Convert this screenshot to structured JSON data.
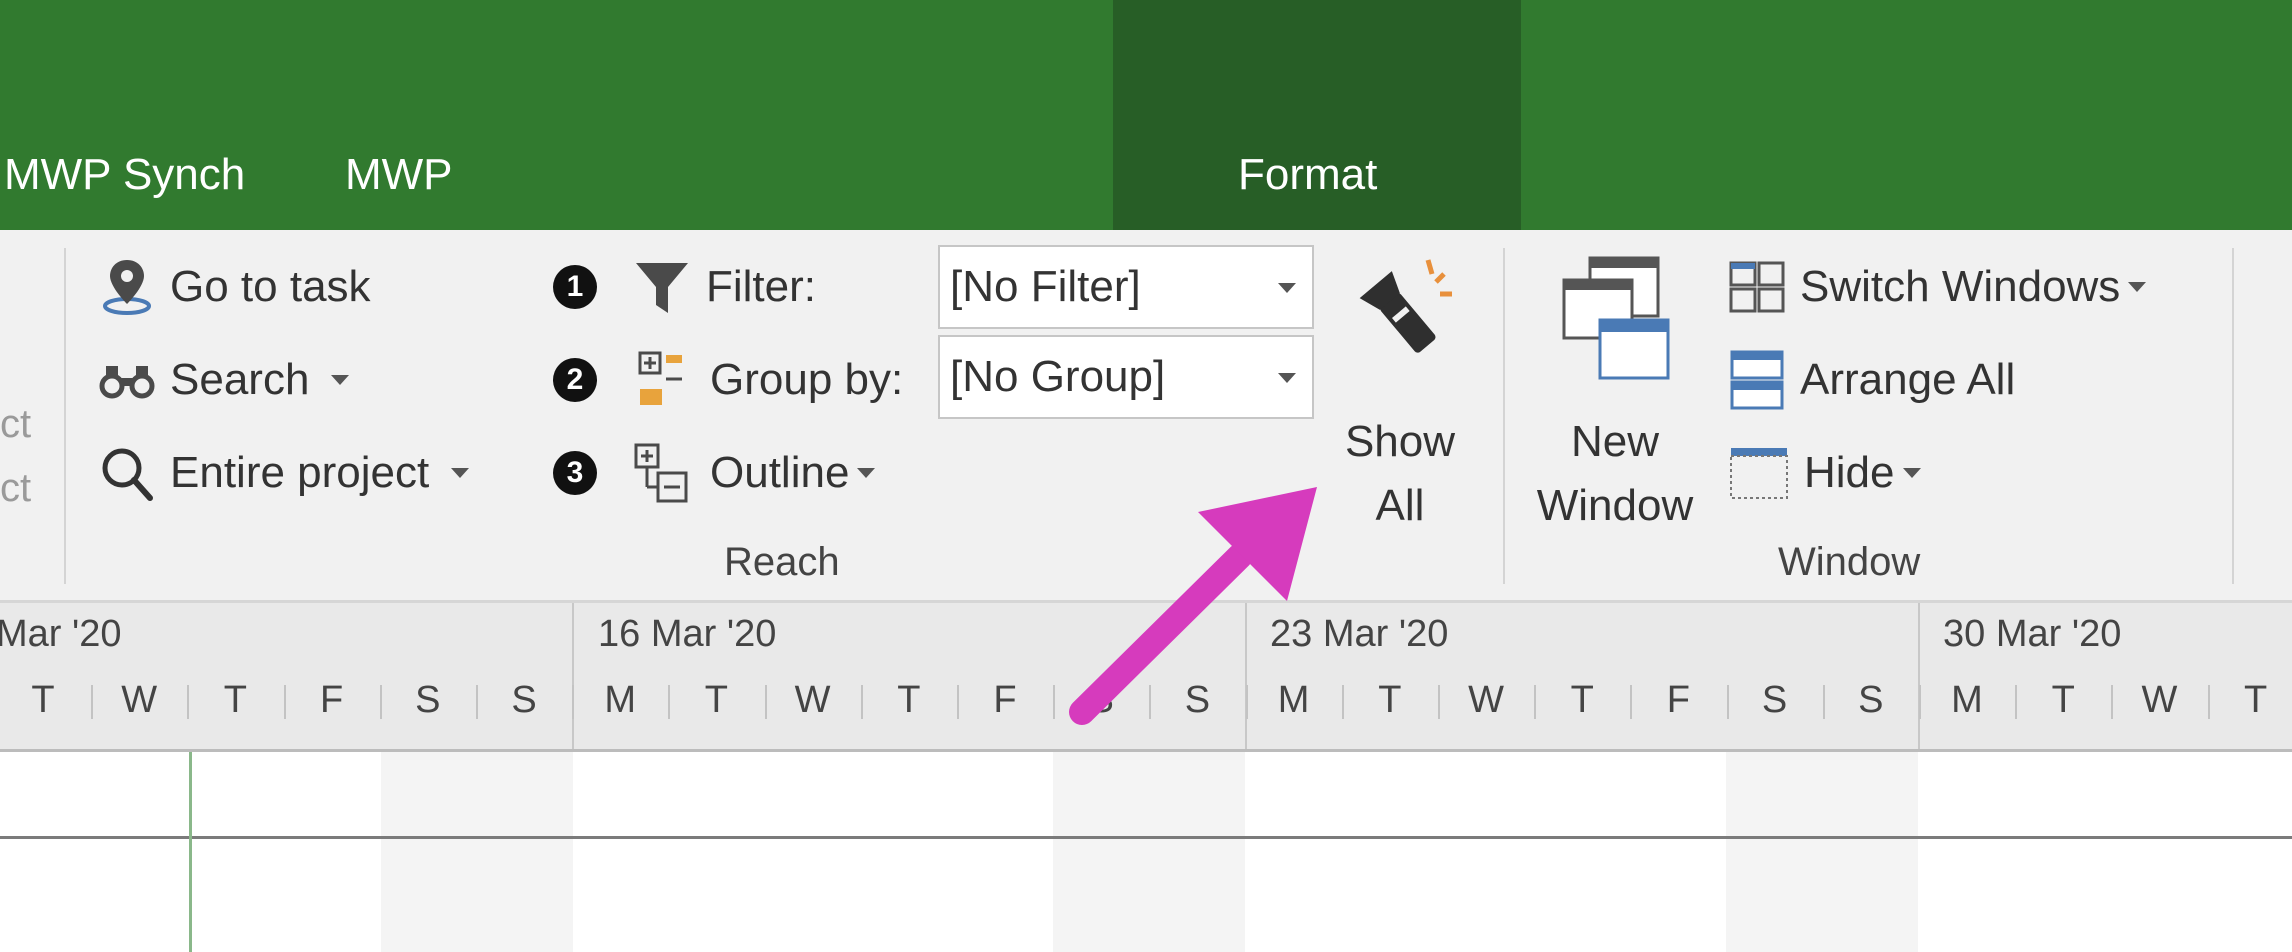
{
  "colors": {
    "tab_bar": "#317a2f",
    "format_context": "#275e26",
    "arrow": "#d63bbd",
    "accent_blue": "#4a7ab5"
  },
  "tabs": [
    {
      "label": "MWP Synch"
    },
    {
      "label": "MWP"
    },
    {
      "label": "Format"
    }
  ],
  "reach": {
    "go_to_task": "Go to task",
    "search": "Search",
    "entire_project": "Entire project",
    "badge1": "1",
    "badge2": "2",
    "badge3": "3",
    "filter_label": "Filter:",
    "group_label": "Group by:",
    "outline_label": "Outline",
    "filter_value": "[No Filter]",
    "group_value": "[No Group]",
    "show_line1": "Show",
    "show_line2": "All",
    "group_name": "Reach",
    "faded1": "ct",
    "faded2": "ct"
  },
  "window": {
    "new_line1": "New",
    "new_line2": "Window",
    "switch_windows": "Switch Windows",
    "arrange_all": "Arrange All",
    "hide": "Hide",
    "group_name": "Window"
  },
  "timescale": {
    "weeks": [
      "Mar '20",
      "16 Mar '20",
      "23 Mar '20",
      "30 Mar '20"
    ],
    "days": [
      "T",
      "W",
      "T",
      "F",
      "S",
      "S",
      "M",
      "T",
      "W",
      "T",
      "F",
      "S",
      "S",
      "M",
      "T",
      "W",
      "T",
      "F",
      "S",
      "S",
      "M",
      "T",
      "W",
      "T"
    ]
  },
  "icons": [
    "map-pin-icon",
    "binoculars-icon",
    "magnifier-icon",
    "funnel-icon",
    "group-by-icon",
    "outline-icon",
    "flashlight-icon",
    "new-window-icon",
    "switch-windows-icon",
    "arrange-all-icon",
    "hide-window-icon"
  ]
}
